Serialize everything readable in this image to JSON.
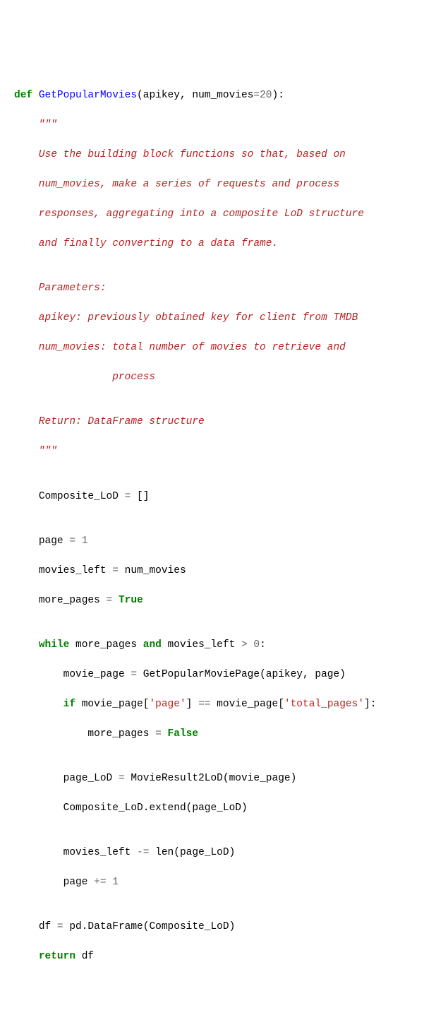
{
  "code": {
    "kw_def": "def",
    "func_name": "GetPopularMovies",
    "paren_open": "(",
    "param_apikey": "apikey",
    "comma_space": ", ",
    "param_nummovies": "num_movies",
    "eq": "=",
    "num_20": "20",
    "paren_close_colon": "):",
    "docstr_open": "    \"\"\"",
    "docstr_l1": "    Use the building block functions so that, based on",
    "docstr_l2": "    num_movies, make a series of requests and process",
    "docstr_l3": "    responses, aggregating into a composite LoD structure",
    "docstr_l4": "    and finally converting to a data frame.",
    "docstr_blank1": "",
    "docstr_l5": "    Parameters:",
    "docstr_l6": "    apikey: previously obtained key for client from TMDB",
    "docstr_l7": "    num_movies: total number of movies to retrieve and",
    "docstr_l8": "                process",
    "docstr_blank2": "",
    "docstr_l9": "    Return: DataFrame structure",
    "docstr_close": "    \"\"\"",
    "blank": "",
    "indent1": "    ",
    "indent2": "        ",
    "indent3": "            ",
    "var_composite": "Composite_LoD ",
    "assign_eq": "=",
    "space": " ",
    "empty_list": "[]",
    "var_page": "page ",
    "num_1": "1",
    "var_movies_left": "movies_left ",
    "var_num_movies": " num_movies",
    "var_more_pages": "more_pages ",
    "bool_true": "True",
    "bool_false": "False",
    "kw_while": "while",
    "more_pages_ref": " more_pages ",
    "kw_and": "and",
    "movies_left_ref": " movies_left ",
    "gt": ">",
    "num_0": "0",
    "colon": ":",
    "var_movie_page": "movie_page ",
    "fn_getpop": " GetPopularMoviePage(apikey, page)",
    "kw_if": "if",
    "movie_page_ref": " movie_page[",
    "str_page": "'page'",
    "close_bracket": "] ",
    "eqeq": "==",
    "movie_page_ref2": " movie_page[",
    "str_total_pages": "'total_pages'",
    "close_bracket_colon": "]:",
    "more_pages_assign": "more_pages ",
    "var_page_lod": "page_LoD ",
    "fn_movieresult": " MovieResult2LoD(movie_page)",
    "composite_extend": "Composite_LoD",
    "dot_extend": ".extend(page_LoD)",
    "movies_left_assign": "movies_left ",
    "minus_eq": "-=",
    "len_call": " len(page_LoD)",
    "page_assign": "page ",
    "plus_eq": "+=",
    "space_1": " 1",
    "var_df": "df ",
    "pd_dataframe": " pd",
    "dot_dataframe": ".DataFrame(Composite_LoD)",
    "kw_return": "return",
    "df_ref": " df"
  }
}
